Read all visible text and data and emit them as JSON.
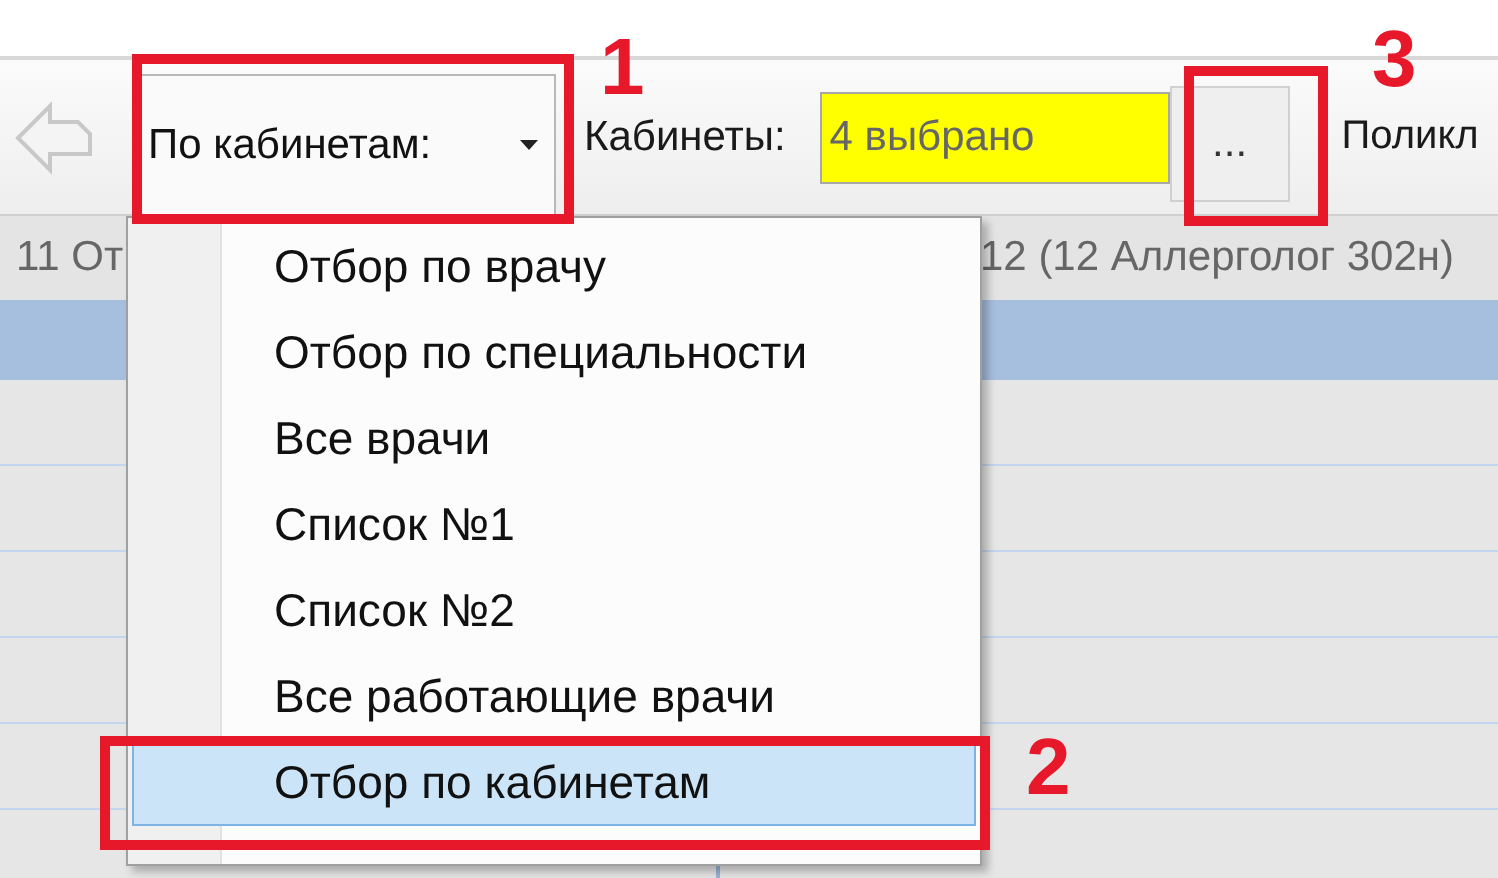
{
  "toolbar": {
    "filter_dropdown": {
      "label": "По кабинетам:",
      "expanded": true
    },
    "cabinets_label": "Кабинеты:",
    "cabinets_field": {
      "value": "4 выбрано"
    },
    "browse_button": "...",
    "next_label": "Поликл"
  },
  "grid": {
    "columns": [
      "11 От",
      "12 (12 Аллерголог 302н)"
    ]
  },
  "menu": {
    "items": [
      {
        "label": "Отбор по врачу",
        "selected": false
      },
      {
        "label": "Отбор по специальности",
        "selected": false
      },
      {
        "label": "Все врачи",
        "selected": false
      },
      {
        "label": "Список №1",
        "selected": false
      },
      {
        "label": "Список №2",
        "selected": false
      },
      {
        "label": "Все работающие врачи",
        "selected": false
      },
      {
        "label": "Отбор по кабинетам",
        "selected": true
      }
    ]
  },
  "annotations": [
    {
      "label": "1"
    },
    {
      "label": "2"
    },
    {
      "label": "3"
    }
  ]
}
